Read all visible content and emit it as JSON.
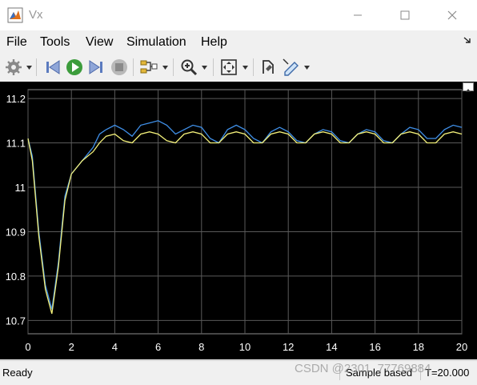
{
  "window": {
    "title": "Vx"
  },
  "menu": [
    "File",
    "Tools",
    "View",
    "Simulation",
    "Help"
  ],
  "toolbar": {
    "buttons": [
      "settings-icon",
      "step-back-icon",
      "run-icon",
      "step-forward-icon",
      "stop-icon",
      "signal-select-icon",
      "zoom-in-icon",
      "fit-to-view-icon",
      "style-icon",
      "highlight-icon"
    ]
  },
  "colors": {
    "plot_bg": "#000000",
    "axes_bg": "#000000",
    "grid": "#5a5a5a",
    "axis_text": "#ffffff",
    "series1": "#3f8fe8",
    "series2": "#f3f07a"
  },
  "chart_data": {
    "type": "line",
    "title": "",
    "xlabel": "",
    "ylabel": "",
    "xlim": [
      0,
      20
    ],
    "ylim": [
      10.67,
      11.22
    ],
    "xticks": [
      "0",
      "2",
      "4",
      "6",
      "8",
      "10",
      "12",
      "14",
      "16",
      "18",
      "20"
    ],
    "yticks": [
      "10.7",
      "10.8",
      "10.9",
      "11",
      "11.1",
      "11.2"
    ],
    "grid": true,
    "series": [
      {
        "color": "#3f8fe8",
        "x": [
          0,
          0.2,
          0.5,
          0.8,
          1.1,
          1.4,
          1.7,
          2,
          2.5,
          3,
          3.3,
          3.6,
          4,
          4.4,
          4.8,
          5.2,
          5.6,
          6,
          6.4,
          6.8,
          7.2,
          7.6,
          8,
          8.4,
          8.8,
          9.2,
          9.6,
          10,
          10.4,
          10.8,
          11.2,
          11.6,
          12,
          12.4,
          12.8,
          13.2,
          13.6,
          14,
          14.4,
          14.8,
          15.2,
          15.6,
          16,
          16.4,
          16.8,
          17.2,
          17.6,
          18,
          18.4,
          18.8,
          19.2,
          19.6,
          20
        ],
        "y": [
          11.11,
          11.07,
          10.9,
          10.78,
          10.725,
          10.83,
          10.98,
          11.03,
          11.06,
          11.09,
          11.12,
          11.13,
          11.14,
          11.13,
          11.115,
          11.14,
          11.145,
          11.15,
          11.14,
          11.12,
          11.13,
          11.14,
          11.135,
          11.11,
          11.1,
          11.13,
          11.14,
          11.13,
          11.11,
          11.1,
          11.125,
          11.135,
          11.125,
          11.105,
          11.1,
          11.12,
          11.13,
          11.125,
          11.105,
          11.1,
          11.12,
          11.13,
          11.125,
          11.105,
          11.1,
          11.12,
          11.135,
          11.13,
          11.11,
          11.11,
          11.13,
          11.14,
          11.135
        ]
      },
      {
        "color": "#f3f07a",
        "x": [
          0,
          0.2,
          0.5,
          0.8,
          1.1,
          1.4,
          1.7,
          2,
          2.5,
          3,
          3.3,
          3.6,
          4,
          4.4,
          4.8,
          5.2,
          5.6,
          6,
          6.4,
          6.8,
          7.2,
          7.6,
          8,
          8.4,
          8.8,
          9.2,
          9.6,
          10,
          10.4,
          10.8,
          11.2,
          11.6,
          12,
          12.4,
          12.8,
          13.2,
          13.6,
          14,
          14.4,
          14.8,
          15.2,
          15.6,
          16,
          16.4,
          16.8,
          17.2,
          17.6,
          18,
          18.4,
          18.8,
          19.2,
          19.6,
          20
        ],
        "y": [
          11.11,
          11.06,
          10.89,
          10.77,
          10.715,
          10.82,
          10.97,
          11.03,
          11.06,
          11.08,
          11.1,
          11.115,
          11.12,
          11.105,
          11.1,
          11.12,
          11.125,
          11.12,
          11.105,
          11.1,
          11.12,
          11.125,
          11.12,
          11.1,
          11.1,
          11.12,
          11.125,
          11.12,
          11.1,
          11.1,
          11.12,
          11.125,
          11.12,
          11.1,
          11.1,
          11.12,
          11.125,
          11.12,
          11.1,
          11.1,
          11.12,
          11.125,
          11.12,
          11.1,
          11.1,
          11.12,
          11.125,
          11.12,
          11.1,
          11.1,
          11.12,
          11.125,
          11.12
        ]
      }
    ]
  },
  "status": {
    "ready": "Ready",
    "mode": "Sample based",
    "time": "T=20.000"
  },
  "watermark": "CSDN @2301_77769884"
}
